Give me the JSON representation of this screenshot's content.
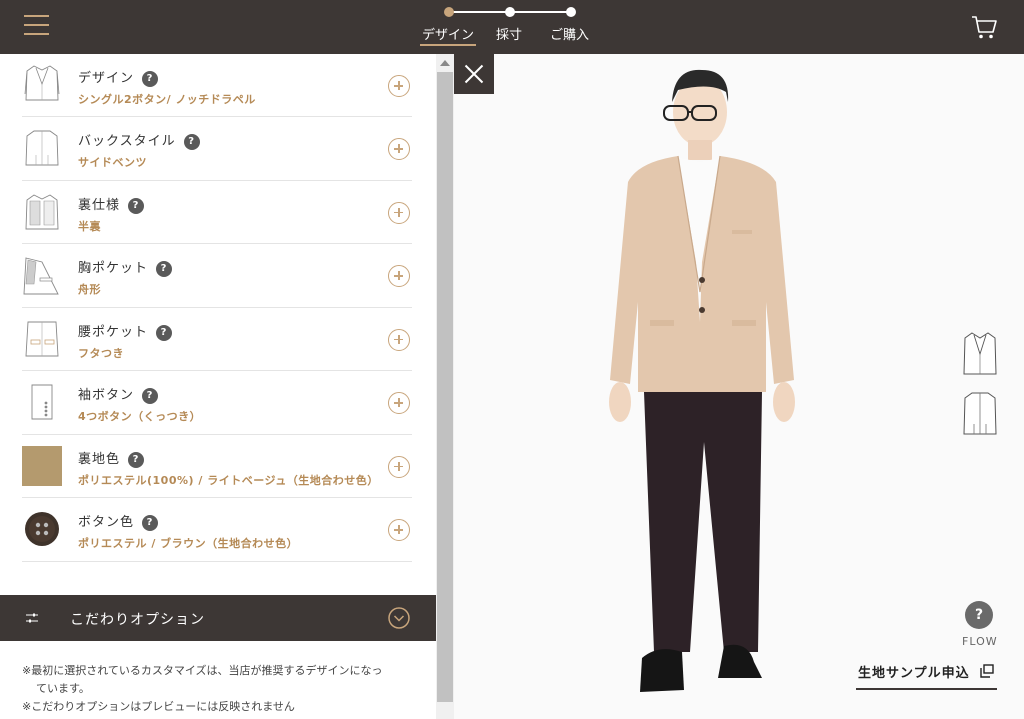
{
  "header": {
    "steps": [
      {
        "label": "デザイン",
        "active": true
      },
      {
        "label": "採寸",
        "active": false
      },
      {
        "label": "ご購入",
        "active": false
      }
    ],
    "accent_color": "#c8a57c",
    "bar_color": "#3d3735"
  },
  "design_options": [
    {
      "title": "デザイン",
      "value": "シングル2ボタン/ ノッチドラペル",
      "icon": "jacket-front-icon"
    },
    {
      "title": "バックスタイル",
      "value": "サイドベンツ",
      "icon": "jacket-back-icon"
    },
    {
      "title": "裏仕様",
      "value": "半裏",
      "icon": "jacket-lining-icon"
    },
    {
      "title": "胸ポケット",
      "value": "舟形",
      "icon": "chest-pocket-icon"
    },
    {
      "title": "腰ポケット",
      "value": "フタつき",
      "icon": "waist-pocket-icon"
    },
    {
      "title": "袖ボタン",
      "value": "4つボタン（くっつき）",
      "icon": "sleeve-button-icon"
    },
    {
      "title": "裏地色",
      "value": "ポリエステル(100%) / ライトベージュ（生地合わせ色）",
      "icon": "lining-swatch",
      "swatch_color": "#b49a6e"
    },
    {
      "title": "ボタン色",
      "value": "ポリエステル / ブラウン（生地合わせ色）",
      "icon": "button-swatch",
      "swatch_color": "#4a3a30"
    }
  ],
  "help_symbol": "?",
  "option_bar": {
    "label": "こだわりオプション"
  },
  "notes": [
    "※最初に選択されているカスタマイズは、当店が推奨するデザインになっ",
    "ています。",
    "※こだわりオプションはプレビューには反映されません"
  ],
  "preview": {
    "flow_symbol": "?",
    "flow_label": "FLOW",
    "sample_label": "生地サンプル申込"
  }
}
